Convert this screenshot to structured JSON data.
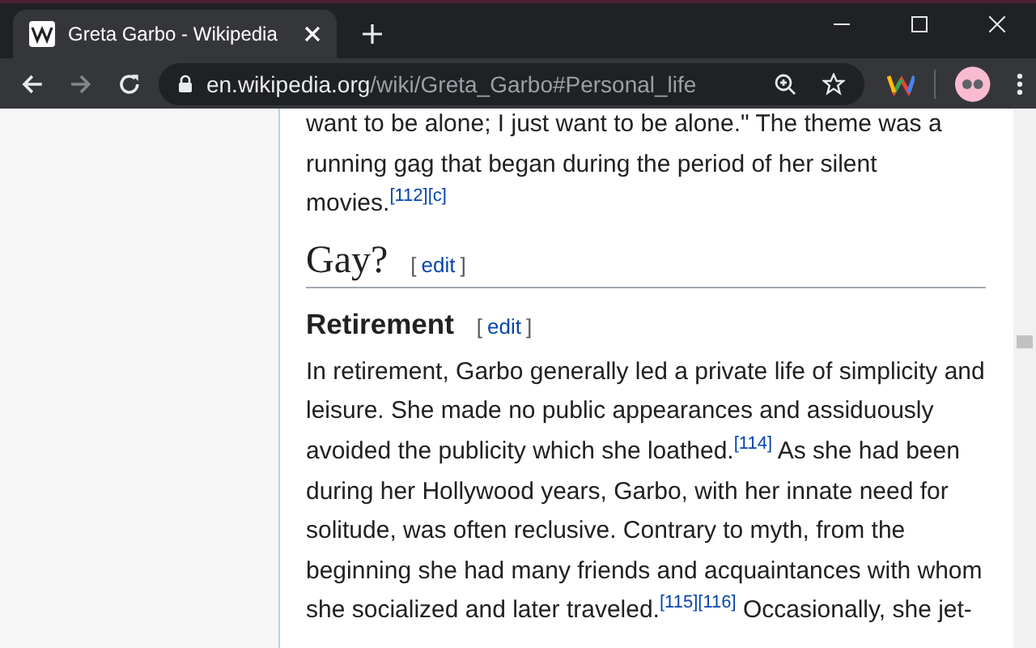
{
  "browser": {
    "tab": {
      "title": "Greta Garbo - Wikipedia",
      "selected": true
    },
    "url": {
      "host": "en.wikipedia.org",
      "path": "/wiki/Greta_Garbo#Personal_life"
    }
  },
  "article": [
    {
      "kind": "paragraph",
      "parts": [
        {
          "kind": "text",
          "text": "want to be alone; I just want to be alone.\" The theme was a running gag that began during the period of her silent movies."
        },
        {
          "kind": "ref",
          "text": "[112]"
        },
        {
          "kind": "ref",
          "text": "[c]"
        }
      ]
    },
    {
      "kind": "h2",
      "title": "Gay?",
      "edit_open": "[",
      "edit": "edit",
      "edit_close": "]"
    },
    {
      "kind": "h3",
      "title": "Retirement",
      "edit_open": "[",
      "edit": "edit",
      "edit_close": "]"
    },
    {
      "kind": "paragraph",
      "parts": [
        {
          "kind": "text",
          "text": "In retirement, Garbo generally led a private life of simplicity and leisure. She made no public appearances and assiduously avoided the publicity which she loathed."
        },
        {
          "kind": "ref",
          "text": "[114]"
        },
        {
          "kind": "text",
          "text": " As she had been during her Hollywood years, Garbo, with her innate need for solitude, was often reclusive. Contrary to myth, from the beginning she had many friends and acquaintances with whom she socialized and later traveled."
        },
        {
          "kind": "ref",
          "text": "[115]"
        },
        {
          "kind": "ref",
          "text": "[116]"
        },
        {
          "kind": "text",
          "text": " Occasionally, she jet-"
        }
      ]
    }
  ]
}
